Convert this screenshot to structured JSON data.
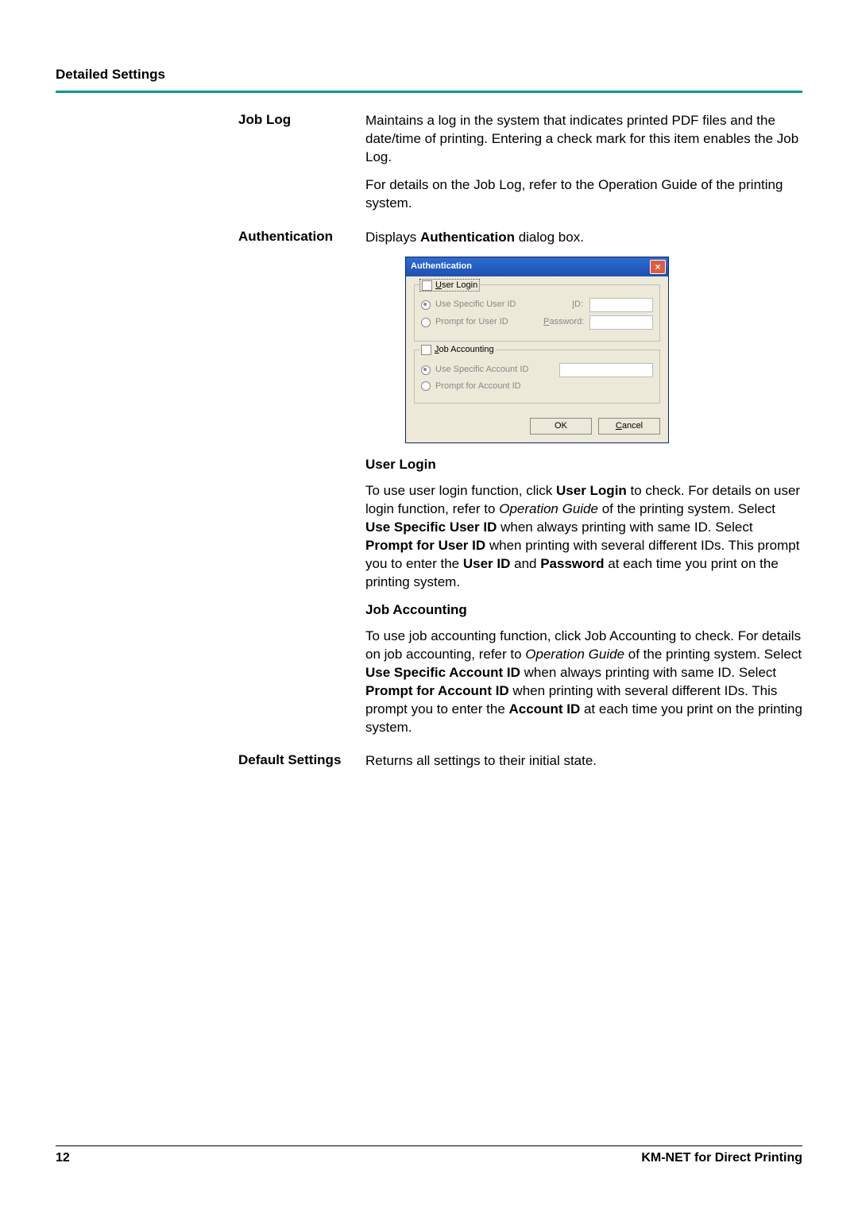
{
  "header": {
    "section_title": "Detailed Settings"
  },
  "rows": {
    "job_log": {
      "label": "Job Log",
      "p1": "Maintains a log in the system that indicates printed PDF files and the date/time of printing. Entering a check mark for this item enables the Job Log.",
      "p2": "For details on the Job Log, refer to the Operation Guide of the printing system."
    },
    "authentication": {
      "label": "Authentication",
      "intro_a": "Displays ",
      "intro_b": "Authentication",
      "intro_c": " dialog box."
    },
    "default_settings": {
      "label": "Default Settings",
      "desc": "Returns all settings to their initial state."
    }
  },
  "dialog": {
    "title": "Authentication",
    "user_login": {
      "legend": "User Login",
      "opt1": "Use Specific User ID",
      "opt2": "Prompt for User ID",
      "id_label": "ID:",
      "password_label": "Password:"
    },
    "job_accounting": {
      "legend": "Job Accounting",
      "opt1": "Use Specific Account ID",
      "opt2": "Prompt for Account ID"
    },
    "ok": "OK",
    "cancel": "Cancel"
  },
  "user_login_section": {
    "heading": "User Login",
    "t1": "To use user login function, click ",
    "b1": "User Login",
    "t2": " to check. For details on user login function, refer to ",
    "i1": "Operation Guide",
    "t3": " of the printing system. Select ",
    "b2": "Use Specific User ID",
    "t4": " when always printing with same ID. Select ",
    "b3": "Prompt for User ID",
    "t5": " when printing with several different IDs. This prompt you to enter the ",
    "b4": "User ID",
    "t6": " and ",
    "b5": "Password",
    "t7": " at each time you print on the printing system."
  },
  "job_accounting_section": {
    "heading": "Job Accounting",
    "t1": "To use job accounting function, click Job Accounting to check. For details on job accounting, refer to ",
    "i1": "Operation Guide",
    "t2": " of the printing system. Select ",
    "b1": "Use Specific Account ID",
    "t3": " when always printing with same ID. Select ",
    "b2": "Prompt for Account ID",
    "t4": " when printing with several different IDs. This prompt you to enter the ",
    "b3": "Account ID",
    "t5": " at each time you print on the printing system."
  },
  "footer": {
    "page_number": "12",
    "product": "KM-NET for Direct Printing"
  }
}
